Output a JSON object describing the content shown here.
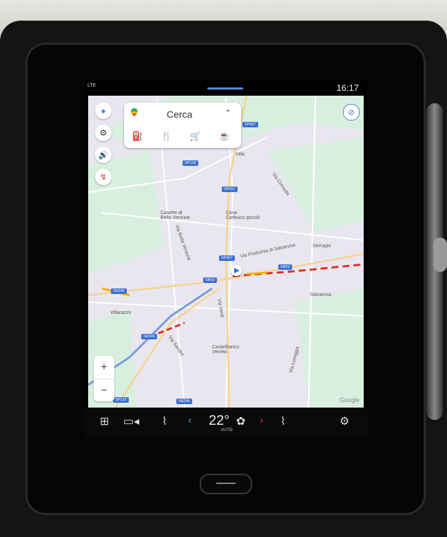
{
  "status": {
    "signal": "LTE",
    "time": "16:17"
  },
  "search": {
    "title": "Cerca",
    "categories": [
      {
        "name": "fuel-icon",
        "glyph": "⛽"
      },
      {
        "name": "restaurant-icon",
        "glyph": "🍴"
      },
      {
        "name": "shopping-cart-icon",
        "glyph": "🛒"
      },
      {
        "name": "coffee-icon",
        "glyph": "☕"
      }
    ]
  },
  "map": {
    "places": [
      {
        "name": "villa",
        "text": "Villa"
      },
      {
        "name": "casette-bella-venezia",
        "text": "Casette di\nBella Venezia"
      },
      {
        "name": "case-carbucci",
        "text": "Case\nCarbucci piccoli"
      },
      {
        "name": "serragio",
        "text": "Serragio"
      },
      {
        "name": "salvarosa",
        "text": "Salvarosa"
      },
      {
        "name": "villarazzo",
        "text": "Villarazzo"
      },
      {
        "name": "castelfranco",
        "text": "Castelfranco\nVeneto"
      }
    ],
    "roads": [
      {
        "name": "via-postumia",
        "text": "Via Postumia di Salvarosa"
      },
      {
        "name": "via-bella-venezia",
        "text": "Via Bella Venezia"
      },
      {
        "name": "via-verdi",
        "text": "Via Verdi"
      },
      {
        "name": "via-cornuda",
        "text": "Via Cornuda"
      },
      {
        "name": "via-sandro",
        "text": "Via Sandro"
      },
      {
        "name": "via-loreggia",
        "text": "Via Loreggia"
      }
    ],
    "shields": [
      {
        "name": "sp667-top",
        "text": "SP667"
      },
      {
        "name": "sp139",
        "text": "SP139"
      },
      {
        "name": "sp667-mid",
        "text": "SP667"
      },
      {
        "name": "sp667-low",
        "text": "SP667"
      },
      {
        "name": "sr53-a",
        "text": "SR53"
      },
      {
        "name": "sr53-b",
        "text": "SR53"
      },
      {
        "name": "sr245-a",
        "text": "SR245"
      },
      {
        "name": "sr245-b",
        "text": "SR245"
      },
      {
        "name": "sp133",
        "text": "SP133"
      },
      {
        "name": "sr245-c",
        "text": "SR245"
      }
    ],
    "attribution": "Google",
    "zoom_in": "+",
    "zoom_out": "−"
  },
  "climate": {
    "temperature": "22°",
    "fan": "AUTO"
  },
  "colors": {
    "accent": "#4a90e2",
    "traffic_red": "#d93025",
    "traffic_yellow": "#f2b300",
    "map_bg": "#e9e6ef"
  }
}
